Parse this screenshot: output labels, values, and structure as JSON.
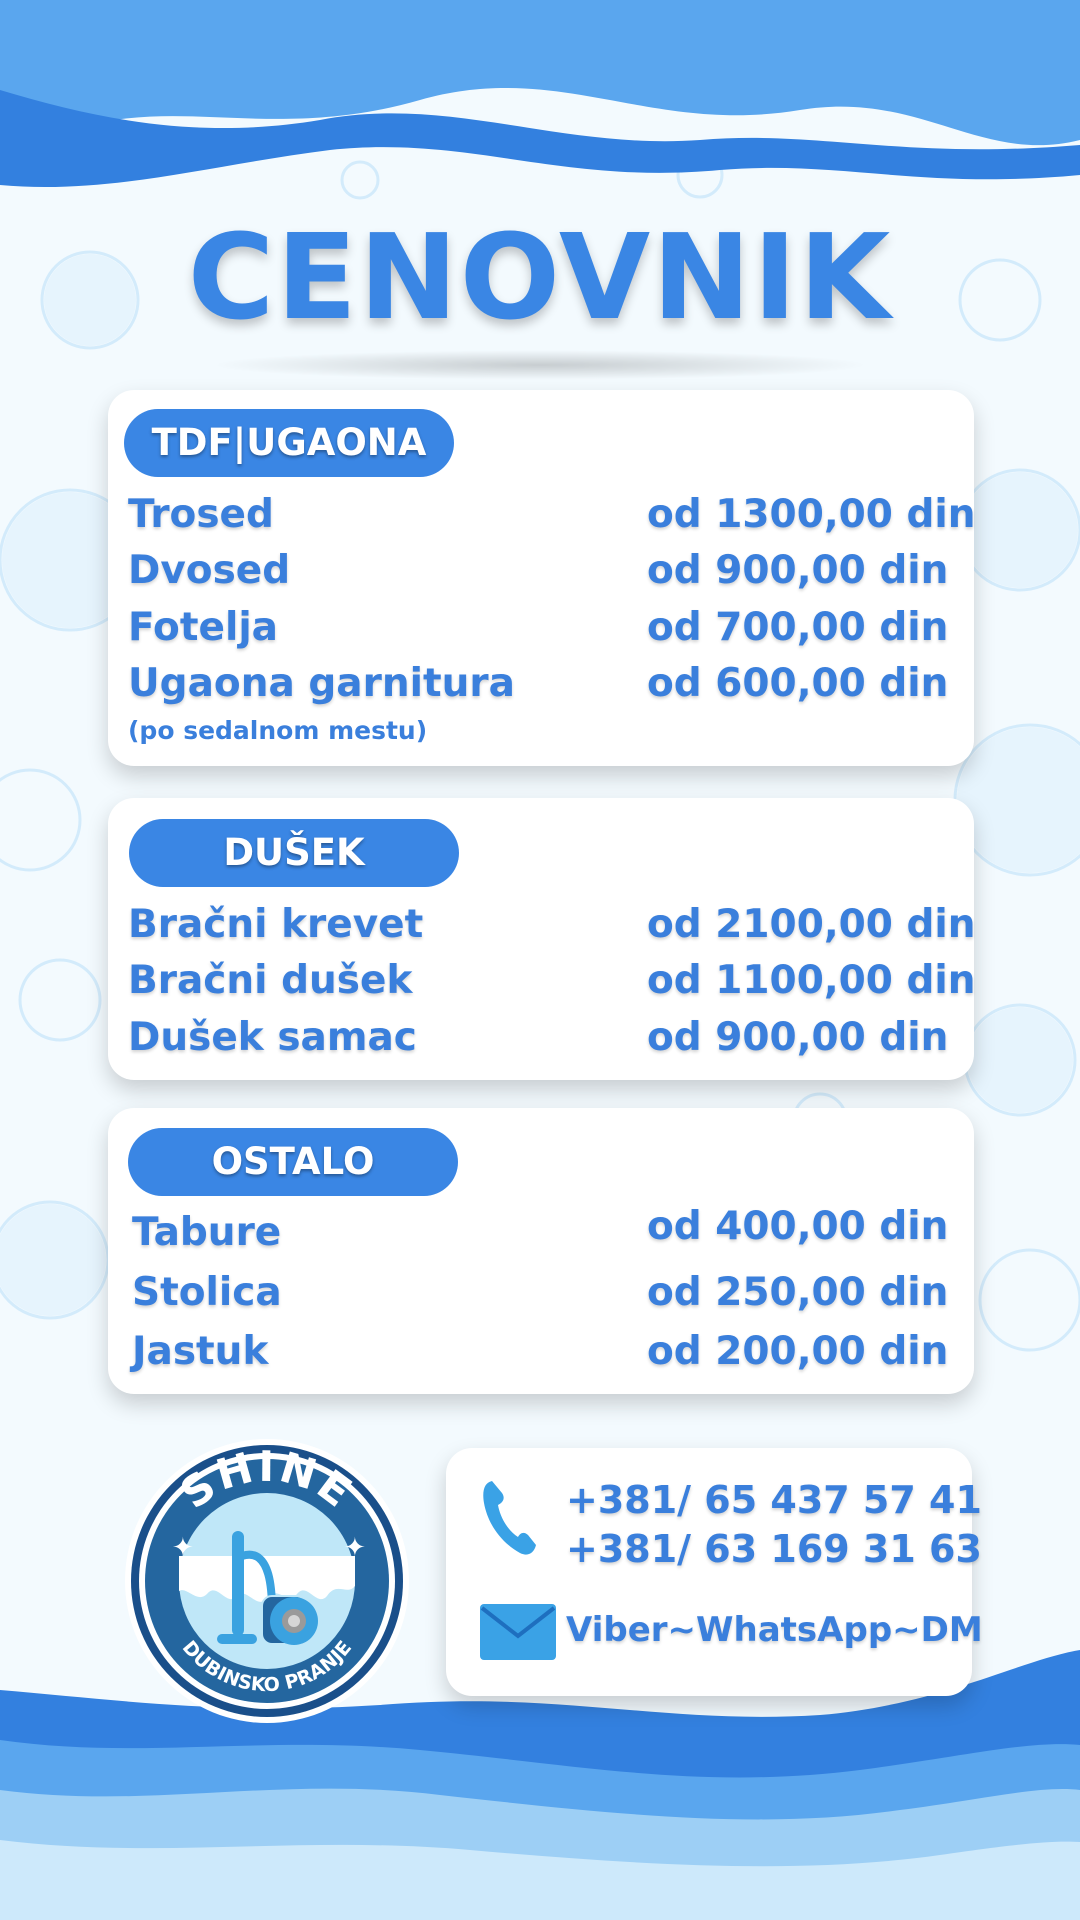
{
  "title": "CENOVNIK",
  "colors": {
    "accent": "#3a86e4",
    "text": "#3a7fdc",
    "background": "#eaf6fd",
    "card": "#ffffff"
  },
  "sections": [
    {
      "header": "TDF|UGAONA",
      "items": [
        {
          "name": "Trosed",
          "price": "od 1300,00 din"
        },
        {
          "name": "Dvosed",
          "price": "od 900,00 din"
        },
        {
          "name": "Fotelja",
          "price": "od 700,00 din"
        },
        {
          "name": "Ugaona garnitura",
          "price": "od 600,00 din",
          "note": "(po sedalnom mestu)"
        }
      ]
    },
    {
      "header": "DUŠEK",
      "items": [
        {
          "name": "Bračni krevet",
          "price": "od 2100,00 din"
        },
        {
          "name": "Bračni dušek",
          "price": "od 1100,00 din"
        },
        {
          "name": "Dušek samac",
          "price": "od 900,00 din"
        }
      ]
    },
    {
      "header": "OSTALO",
      "items": [
        {
          "name": "Tabure",
          "price": "od 400,00 din"
        },
        {
          "name": "Stolica",
          "price": "od 250,00 din"
        },
        {
          "name": "Jastuk",
          "price": "od 200,00 din"
        }
      ]
    }
  ],
  "logo": {
    "brand": "SHINE",
    "tagline": "DUBINSKO PRANJE",
    "icon": "vacuum-cleaner-icon"
  },
  "contact": {
    "phones": [
      "+381/ 65 437 57 41",
      "+381/ 63 169 31 63"
    ],
    "phone_icon": "phone-icon",
    "messaging": "Viber~WhatsApp~DM",
    "messaging_icon": "envelope-icon"
  }
}
